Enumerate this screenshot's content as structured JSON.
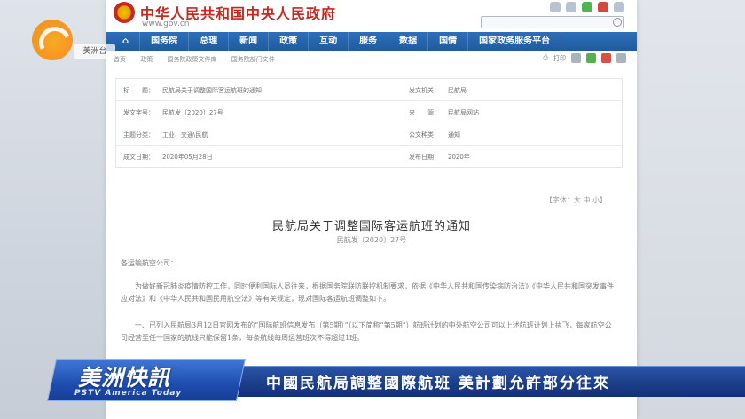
{
  "station": {
    "logo_tag": "美洲台",
    "brand": "美洲快訊",
    "brand_sub": "PSTV America Today",
    "headline": "中國民航局調整國際航班 美計劃允許部分往來"
  },
  "site": {
    "title": "中华人民共和国中央人民政府",
    "url": "www.gov.cn",
    "nav": [
      "国务院",
      "总理",
      "新闻",
      "政策",
      "互动",
      "服务",
      "数据",
      "国情",
      "国家政务服务平台"
    ]
  },
  "breadcrumb": [
    "首页",
    "政策",
    "国务院政策文件库",
    "国务院部门文件"
  ],
  "share": {
    "print_label": "打印"
  },
  "meta": [
    {
      "label": "标　　题：",
      "value": "民航局关于调整国际客运航班的通知",
      "label2": "发文机关：",
      "value2": "民航局"
    },
    {
      "label": "发文字号：",
      "value": "民航发〔2020〕27号",
      "label2": "来　　源：",
      "value2": "民航局网站"
    },
    {
      "label": "主题分类：",
      "value": "工业、交通\\民航",
      "label2": "公文种类：",
      "value2": "通知"
    },
    {
      "label": "成文日期：",
      "value": "2020年05月28日",
      "label2": "发布日期：",
      "value2": "2020年"
    }
  ],
  "font_control": "【字体：大 中 小】",
  "document": {
    "title": "民航局关于调整国际客运航班的通知",
    "number": "民航发〔2020〕27号",
    "addressee": "各运输航空公司：",
    "para1": "为做好新冠肺炎疫情防控工作，同时便利国际人员往来，根据国务院联防联控机制要求，依据《中华人民共和国传染病防治法》《中华人民共和国突发事件应对法》和《中华人民共和国民用航空法》等有关规定，现对国际客运航班调整如下。",
    "para2": "一、已列入民航局3月12日官网发布的“国际航班信息发布（第5期）”（以下简称“第5期”）航班计划的中外航空公司可以上述航班计划上执飞，每家航空公司经营至任一国家的航线只能保留1条，每条航线每周运营班次不得超过1班。"
  }
}
